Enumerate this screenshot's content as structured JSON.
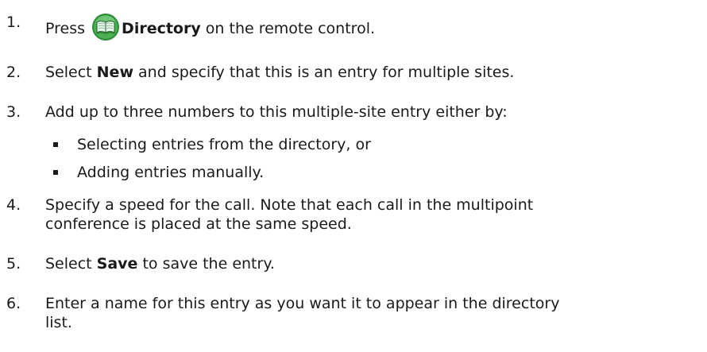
{
  "steps": [
    {
      "number": "1.",
      "pre": "Press",
      "icon": "directory-book-icon",
      "bold": "Directory",
      "post": " on the remote control."
    },
    {
      "number": "2.",
      "pre": "Select ",
      "bold": "New",
      "post": " and specify that this is an entry for multiple sites."
    },
    {
      "number": "3.",
      "text": "Add up to three numbers to this multiple-site entry either by:"
    },
    {
      "number": "4.",
      "line1": "Specify a speed for the call. Note that each call in the multipoint",
      "line2": "conference is placed at the same speed."
    },
    {
      "number": "5.",
      "pre": "Select ",
      "bold": "Save",
      "post": " to save the entry."
    },
    {
      "number": "6.",
      "line1": "Enter a name for this entry as you want it to appear in the directory",
      "line2": "list."
    }
  ],
  "sub_bullets": [
    "Selecting entries from the directory, or",
    "Adding entries manually."
  ],
  "colors": {
    "text": "#1a1a1a",
    "icon_green": "#3c9a3c",
    "icon_light": "#d8f0e0"
  }
}
